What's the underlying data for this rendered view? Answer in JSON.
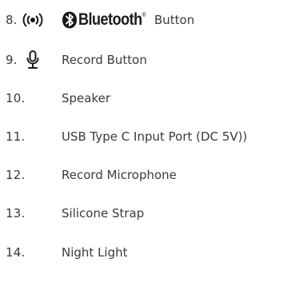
{
  "items": [
    {
      "number": "8.",
      "icon": "radio-waves-icon",
      "brand": "Bluetooth",
      "brand_mark": "®",
      "label": "Button"
    },
    {
      "number": "9.",
      "icon": "microphone-icon",
      "label": "Record Button"
    },
    {
      "number": "10.",
      "label": "Speaker"
    },
    {
      "number": "11.",
      "label": "USB Type C Input Port (DC 5V))"
    },
    {
      "number": "12.",
      "label": "Record Microphone"
    },
    {
      "number": "13.",
      "label": "Silicone Strap"
    },
    {
      "number": "14.",
      "label": "Night Light"
    }
  ],
  "colors": {
    "text": "#3a3a3a",
    "icon": "#1a1a1a"
  }
}
